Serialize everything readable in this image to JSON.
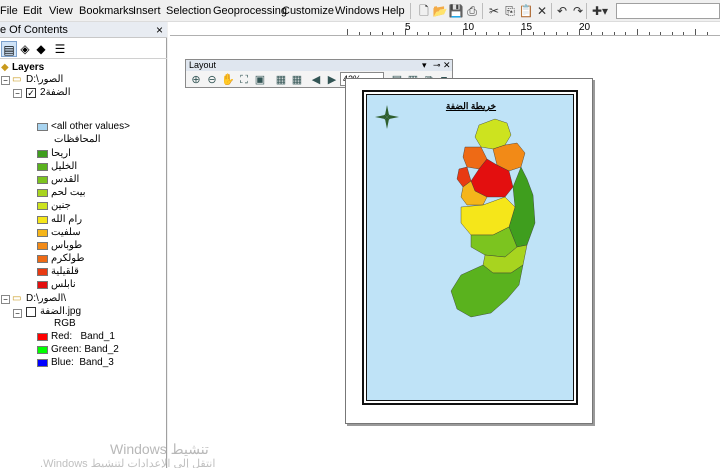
{
  "menu": [
    "File",
    "Edit",
    "View",
    "Bookmarks",
    "Insert",
    "Selection",
    "Geoprocessing",
    "Customize",
    "Windows",
    "Help"
  ],
  "toc": {
    "title": "e Of Contents",
    "close": "×",
    "root_label": "Layers",
    "group1_path": "D:\\الصور",
    "layer1_name": "الضفة2",
    "all_other_values": "<all other values>",
    "field_name": "المحافظات",
    "classes": [
      {
        "label": "اريحا",
        "color": "#3f9e1e"
      },
      {
        "label": "الخليل",
        "color": "#5ab21e"
      },
      {
        "label": "القدس",
        "color": "#7cc41f"
      },
      {
        "label": "بيت لحم",
        "color": "#a8d41f"
      },
      {
        "label": "جنين",
        "color": "#cde31f"
      },
      {
        "label": "رام الله",
        "color": "#f5e61a"
      },
      {
        "label": "سلفيت",
        "color": "#f5b51a"
      },
      {
        "label": "طوباس",
        "color": "#f28a17"
      },
      {
        "label": "طولكرم",
        "color": "#ee6a15"
      },
      {
        "label": "قلقيلية",
        "color": "#e83a12"
      },
      {
        "label": "نابلس",
        "color": "#e30f0f"
      }
    ],
    "all_other_color": "#a8d4f0",
    "group2_path": "D:\\الصور\\",
    "layer2_name": "الضفة.jpg",
    "rgb_label": "RGB",
    "bands": [
      {
        "label": "Red:   Band_1",
        "color": "#ff0000"
      },
      {
        "label": "Green: Band_2",
        "color": "#00ff00"
      },
      {
        "label": "Blue:  Band_3",
        "color": "#0000ff"
      }
    ]
  },
  "ruler": [
    "5",
    "10",
    "15",
    "20"
  ],
  "layout_toolbar": {
    "title": "Layout",
    "zoom": "42%"
  },
  "map": {
    "title": "خريطة الضفة",
    "sea_color": "#bfe3f7"
  },
  "watermark": {
    "line1": "تنشيط Windows",
    "line2": "انتقل إلى الإعدادات لتنشيط Windows."
  }
}
